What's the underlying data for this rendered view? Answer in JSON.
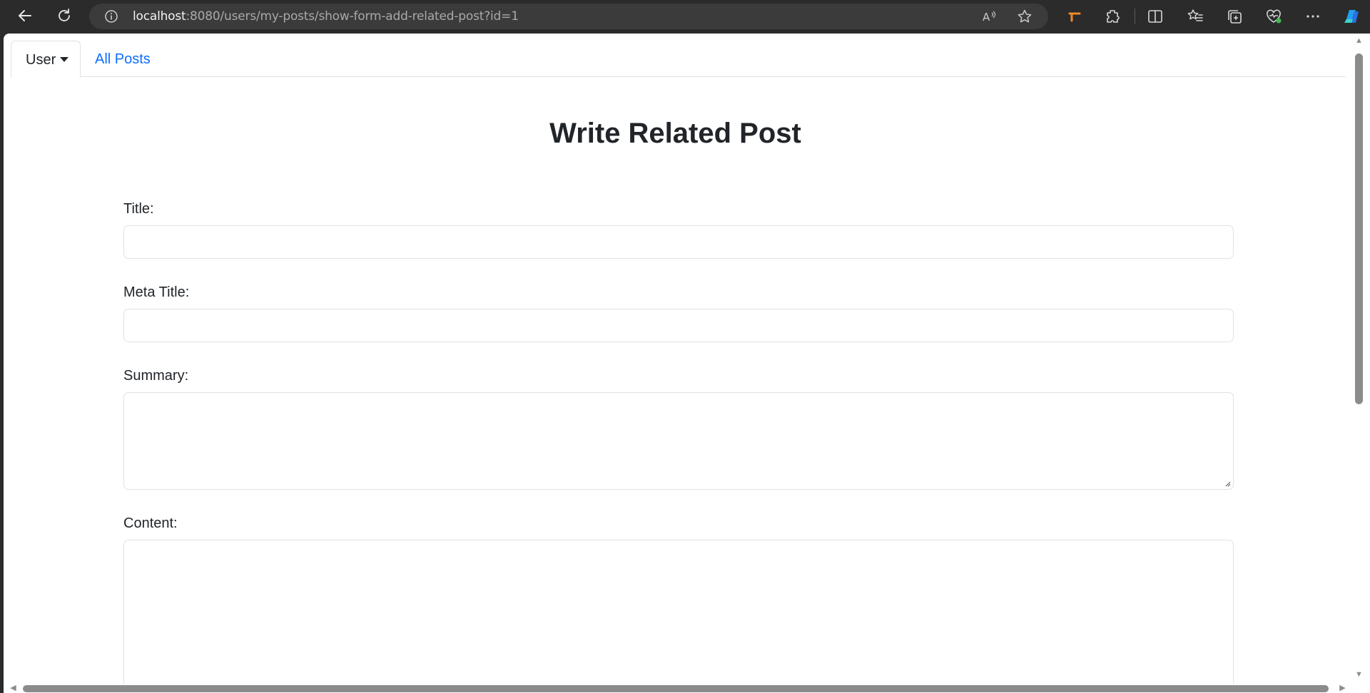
{
  "browser": {
    "url_host": "localhost",
    "url_rest": ":8080/users/my-posts/show-form-add-related-post?id=1",
    "icons": [
      "back-icon",
      "refresh-icon",
      "info-icon",
      "read-aloud-icon",
      "favorite-star-icon",
      "extension-orange-icon",
      "extensions-puzzle-icon",
      "split-screen-icon",
      "favorites-icon",
      "collections-icon",
      "browser-essentials-icon",
      "more-icon",
      "copilot-icon"
    ]
  },
  "nav": {
    "user_tab": "User",
    "all_posts_tab": "All Posts"
  },
  "form": {
    "title": "Write Related Post",
    "title_label": "Title:",
    "meta_title_label": "Meta Title:",
    "summary_label": "Summary:",
    "content_label": "Content:",
    "title_value": "",
    "meta_title_value": "",
    "summary_value": "",
    "content_value": ""
  },
  "colors": {
    "link": "#0d6efd",
    "text": "#212529",
    "border": "#dee2e6",
    "chrome_bg": "#2b2b2b"
  }
}
